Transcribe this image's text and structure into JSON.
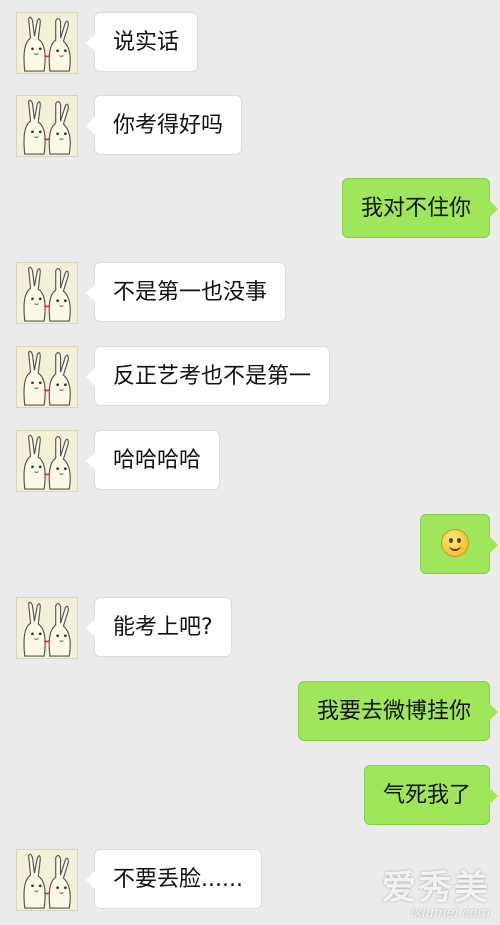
{
  "messages": [
    {
      "side": "in",
      "text": "说实话"
    },
    {
      "side": "in",
      "text": "你考得好吗"
    },
    {
      "side": "out",
      "text": "我对不住你"
    },
    {
      "side": "in",
      "text": "不是第一也没事"
    },
    {
      "side": "in",
      "text": "反正艺考也不是第一"
    },
    {
      "side": "in",
      "text": "哈哈哈哈"
    },
    {
      "side": "out",
      "text": "",
      "icon": "smile-emoji-icon"
    },
    {
      "side": "in",
      "text": "能考上吧?"
    },
    {
      "side": "out",
      "text": "我要去微博挂你"
    },
    {
      "side": "out",
      "text": "气死我了"
    },
    {
      "side": "in",
      "text": "不要丢脸......"
    }
  ],
  "watermark": {
    "logo": "爱秀美",
    "site": "ixiumei.com"
  },
  "colors": {
    "background": "#ebebeb",
    "incoming": "#ffffff",
    "outgoing": "#9fe65a"
  }
}
